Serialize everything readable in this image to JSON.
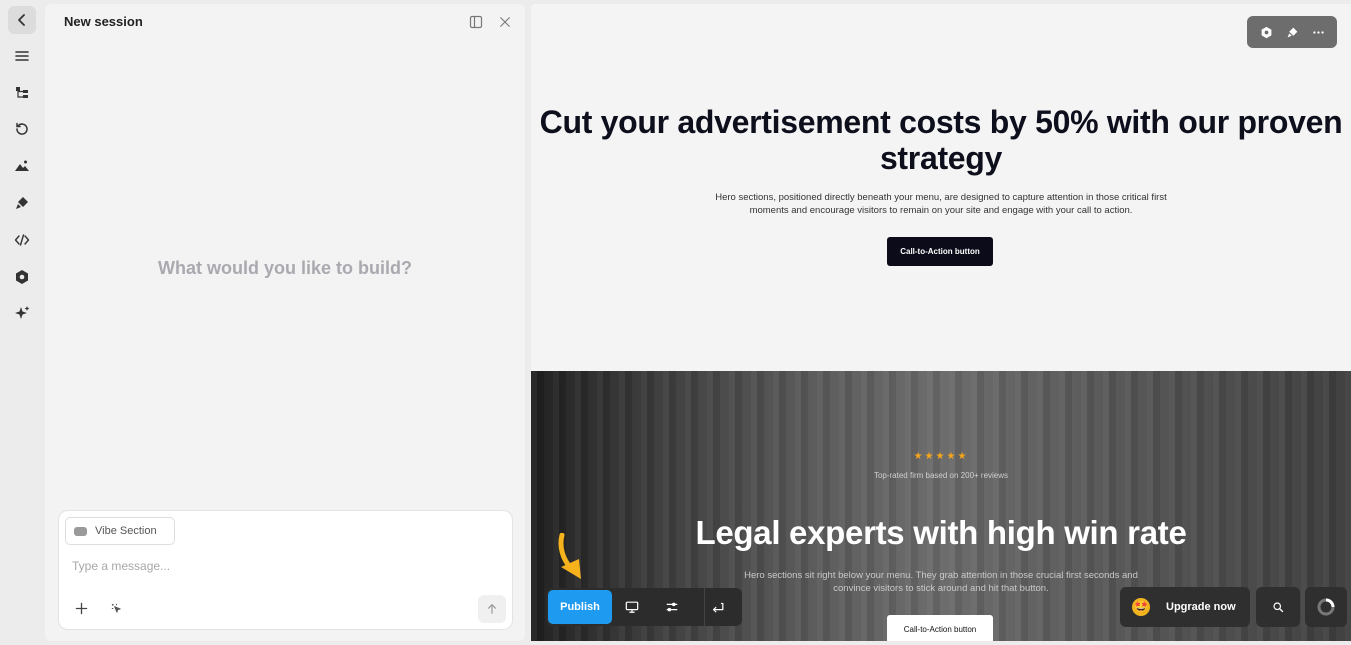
{
  "rail": {
    "items": [
      "chevron-left-icon",
      "menu-icon",
      "layers-icon",
      "history-icon",
      "image-icon",
      "brush-icon",
      "code-icon",
      "settings-icon",
      "sparkle-icon"
    ]
  },
  "panel": {
    "title": "New session",
    "empty_prompt": "What would you like to build?",
    "chip_label": "Vibe Section",
    "message_placeholder": "Type a message..."
  },
  "hero1": {
    "title": "Cut your advertisement costs by 50% with our proven strategy",
    "subtitle": "Hero sections, positioned directly beneath your menu, are designed to capture attention in those critical first moments and encourage visitors to remain on your site and engage with your call to action.",
    "cta_label": "Call-to-Action button"
  },
  "hero2": {
    "stars": "★★★★★",
    "rating_text": "Top-rated firm based on 200+ reviews",
    "title": "Legal experts with high win rate",
    "subtitle": "Hero sections sit right below your menu. They grab attention in those crucial first seconds and convince visitors to stick around and hit that button.",
    "cta_label": "Call-to-Action button"
  },
  "toolbar": {
    "publish_label": "Publish",
    "upgrade_label": "Upgrade now",
    "upgrade_emoji": "🤩"
  },
  "colors": {
    "publish": "#1e9bf0",
    "stars": "#f4a51c",
    "cta_dark": "#0b0b1a",
    "arrow": "#f5b21c"
  }
}
